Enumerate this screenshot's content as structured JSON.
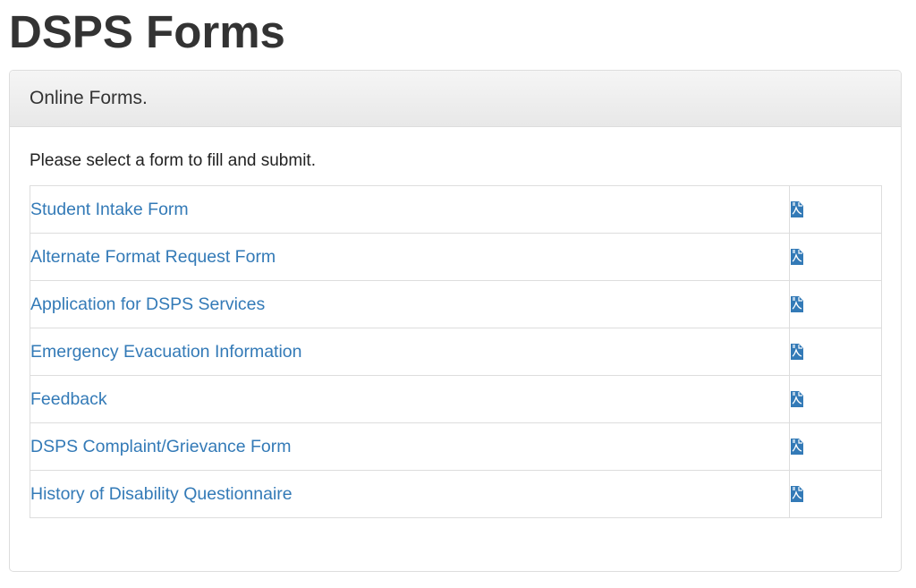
{
  "page": {
    "title": "DSPS Forms"
  },
  "panel": {
    "heading": "Online Forms.",
    "intro": "Please select a form to fill and submit."
  },
  "forms": [
    {
      "name": "Student Intake Form",
      "icon": "pdf-file-icon"
    },
    {
      "name": "Alternate Format Request Form",
      "icon": "pdf-file-icon"
    },
    {
      "name": "Application for DSPS Services",
      "icon": "pdf-file-icon"
    },
    {
      "name": "Emergency Evacuation Information",
      "icon": "pdf-file-icon"
    },
    {
      "name": "Feedback",
      "icon": "pdf-file-icon"
    },
    {
      "name": "DSPS Complaint/Grievance Form",
      "icon": "pdf-file-icon"
    },
    {
      "name": "History of Disability Questionnaire",
      "icon": "pdf-file-icon"
    }
  ],
  "colors": {
    "link": "#337ab7",
    "icon": "#337ab7",
    "text": "#333333",
    "border": "#dddddd"
  }
}
